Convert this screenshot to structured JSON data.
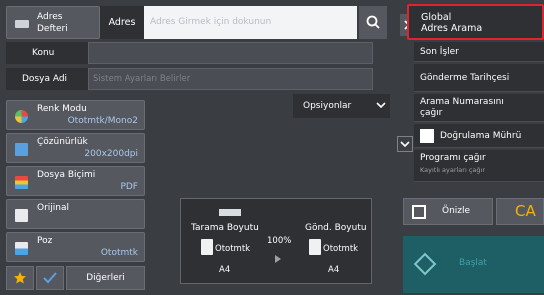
{
  "header": {
    "address_book_label": "Adres\nDefteri",
    "address_label": "Adres",
    "address_placeholder": "Adres Girmek için dokunun"
  },
  "form": {
    "subject_label": "Konu",
    "subject_value": "",
    "filename_label": "Dosya Adi",
    "filename_placeholder": "Sistem Ayarları Belirler",
    "options_label": "Opsiyonlar"
  },
  "settings": [
    {
      "title": "Renk Modu",
      "value": "Ototmtk/Mono2"
    },
    {
      "title": "Çözünürlük",
      "value": "200x200dpi"
    },
    {
      "title": "Dosya Biçimi",
      "value": "PDF"
    },
    {
      "title": "Orijinal",
      "value": ""
    },
    {
      "title": "Poz",
      "value": "Ototmtk"
    }
  ],
  "bottom": {
    "others_label": "Diğerleri"
  },
  "preview": {
    "scan_size_label": "Tarama Boyutu",
    "scan_mode": "Ototmtk",
    "scan_paper": "A4",
    "ratio": "100%",
    "send_size_label": "Gönd. Boyutu",
    "send_mode": "Ototmtk",
    "send_paper": "A4"
  },
  "menu": {
    "global_search": "Global\nAdres Arama",
    "recent_jobs": "Son İşler",
    "send_history": "Gönderme Tarihçesi",
    "call_number_search": "Arama Numarasını\nçağır",
    "verify_seal": "Doğrulama Mührü",
    "recall_program": "Programı çağır",
    "recall_program_sub": "Kayıtlı ayarları çağır"
  },
  "actions": {
    "preview_label": "Önizle",
    "ca_label": "CA",
    "start_label": "Başlat"
  },
  "colors": {
    "accent_blue": "#a9c8ec",
    "highlight_red": "#e2232b",
    "start_teal": "#1e5f66",
    "ca_yellow": "#f2b400"
  }
}
